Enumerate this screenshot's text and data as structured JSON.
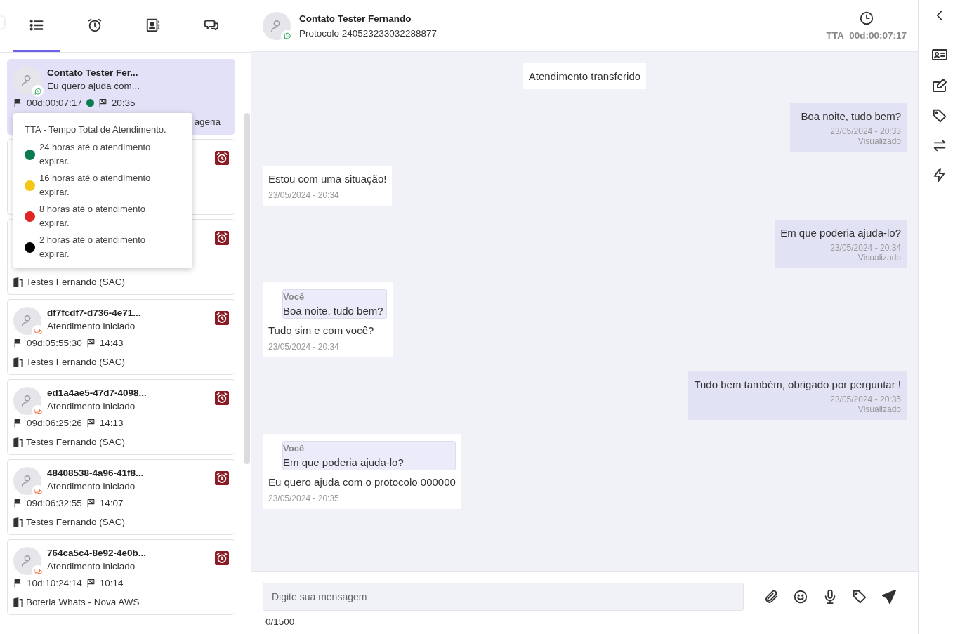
{
  "tabs": [
    {
      "kind": "list",
      "selected": true
    },
    {
      "kind": "alarm",
      "selected": false
    },
    {
      "kind": "contacts",
      "selected": false
    },
    {
      "kind": "chats",
      "selected": false
    }
  ],
  "cards": [
    {
      "kind": "full",
      "selected": true,
      "badge": {
        "kind": "whatsapp"
      },
      "name": "Contato Tester Fer...",
      "preview": "Eu quero ajuda com...",
      "elapsed": "00d:00:07:17",
      "color": "#0a7a50",
      "time": "20:35",
      "department": "ageria",
      "alarm": false
    },
    {
      "kind": "covered",
      "selected": false,
      "alarm": true
    },
    {
      "kind": "covered",
      "selected": false,
      "alarm": true,
      "department": "Testes Fernando (SAC)"
    },
    {
      "kind": "full",
      "selected": false,
      "badge": {
        "kind": "chat"
      },
      "name": "df7fcdf7-d736-4e71...",
      "preview": "Atendimento iniciado",
      "elapsed": "09d:05:55:30",
      "time": "14:43",
      "department": "Testes Fernando (SAC)",
      "alarm": true
    },
    {
      "kind": "full",
      "selected": false,
      "badge": {
        "kind": "chat"
      },
      "name": "ed1a4ae5-47d7-4098...",
      "preview": "Atendimento iniciado",
      "elapsed": "09d:06:25:26",
      "time": "14:13",
      "department": "Testes Fernando (SAC)",
      "alarm": true
    },
    {
      "kind": "full",
      "selected": false,
      "badge": {
        "kind": "chat"
      },
      "name": "48408538-4a96-41f8...",
      "preview": "Atendimento iniciado",
      "elapsed": "09d:06:32:55",
      "time": "14:07",
      "department": "Testes Fernando (SAC)",
      "alarm": true
    },
    {
      "kind": "full",
      "selected": false,
      "badge": {
        "kind": "chat"
      },
      "name": "764ca5c4-8e92-4e0b...",
      "preview": "Atendimento iniciado",
      "elapsed": "10d:10:24:14",
      "time": "10:14",
      "department": "Boteria Whats - Nova AWS",
      "alarm": true
    }
  ],
  "tooltip": {
    "title": "TTA - Tempo Total de Atendimento.",
    "items": [
      {
        "color": "#0a7a50",
        "text": "24 horas até o atendimento expirar."
      },
      {
        "color": "#f5c518",
        "text": "16 horas até o atendimento expirar."
      },
      {
        "color": "#e02424",
        "text": "8 horas até o atendimento expirar."
      },
      {
        "color": "#000000",
        "text": "2 horas até o atendimento expirar."
      }
    ]
  },
  "chat_header": {
    "name": "Contato Tester Fernando",
    "badge": {
      "kind": "whatsapp"
    },
    "protocol": "Protocolo 240523233032288877",
    "tta_label": "TTA",
    "tta_value": "00d:00:07:17"
  },
  "messages": [
    {
      "kind": "system",
      "text": "Atendimento transferido"
    },
    {
      "kind": "outgoing",
      "text": "Boa noite, tudo bem?",
      "time": "23/05/2024 - 20:33",
      "status": "Visualizado"
    },
    {
      "kind": "incoming",
      "text": "Estou com uma situação!",
      "time": "23/05/2024 - 20:34"
    },
    {
      "kind": "outgoing",
      "text": "Em que poderia ajuda-lo?",
      "time": "23/05/2024 - 20:34",
      "status": "Visualizado"
    },
    {
      "kind": "incoming",
      "quote": {
        "author": "Você",
        "text": "Boa noite, tudo bem?"
      },
      "text": "Tudo sim e com você?",
      "time": "23/05/2024 - 20:34"
    },
    {
      "kind": "outgoing",
      "text": "Tudo bem também, obrigado por perguntar !",
      "time": "23/05/2024 - 20:35",
      "status": "Visualizado"
    },
    {
      "kind": "incoming",
      "quote": {
        "author": "Você",
        "text": "Em que poderia ajuda-lo?"
      },
      "text": "Eu quero ajuda com o protocolo 000000",
      "time": "23/05/2024 - 20:35"
    }
  ],
  "composer": {
    "placeholder": "Digite sua mensagem",
    "counter": "0/1500"
  }
}
